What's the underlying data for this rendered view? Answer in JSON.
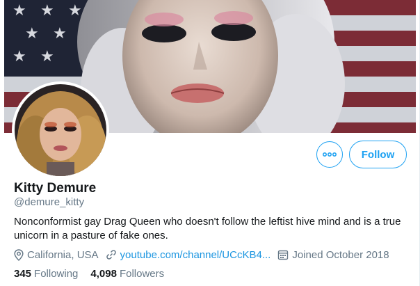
{
  "profile": {
    "name": "Kitty Demure",
    "handle": "@demure_kitty",
    "bio": "Nonconformist gay Drag Queen who doesn't follow the leftist hive mind and is a true unicorn in a pasture of fake ones.",
    "location": "California, USA",
    "website": "youtube.com/channel/UCcKB4...",
    "joined": "Joined October 2018"
  },
  "actions": {
    "follow_label": "Follow",
    "more_icon": "more-dots-icon"
  },
  "stats": {
    "following_count": "345",
    "following_label": "Following",
    "followers_count": "4,098",
    "followers_label": "Followers"
  },
  "colors": {
    "accent": "#1da1f2",
    "link": "#1b95e0",
    "secondary_text": "#657786",
    "primary_text": "#14171a"
  },
  "icons": {
    "location": "location-pin-icon",
    "website": "link-icon",
    "joined": "calendar-icon"
  }
}
